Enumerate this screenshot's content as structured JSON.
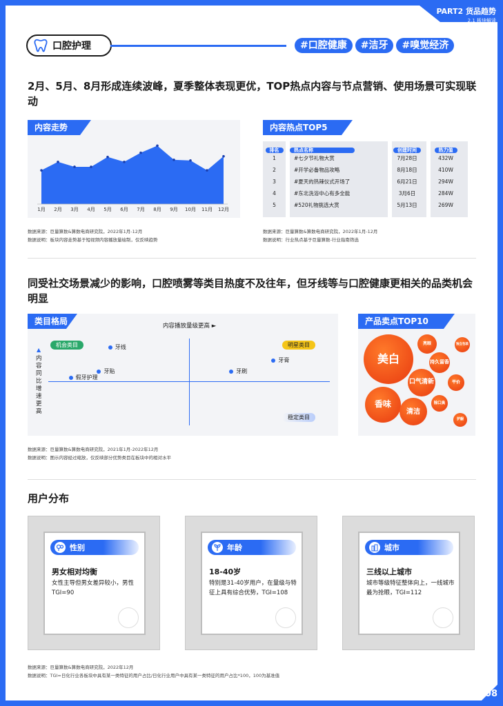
{
  "part": {
    "title": "PART2 货品趋势",
    "sub": "2.1 板块解读"
  },
  "page_number": "08",
  "brand": {
    "icon": "tooth-icon",
    "name": "口腔护理"
  },
  "tags": [
    "#口腔健康",
    "#洁牙",
    "#嗅觉经济"
  ],
  "section1": {
    "headline": "2月、5月、8月形成连续波峰，夏季整体表现更优，TOP热点内容与节点营销、使用场景可实现联动",
    "trend_tab": "内容走势",
    "top5_tab": "内容热点TOP5",
    "trend_note1": "数据来源：巨量算数&算数电商研究院，2022年1月-12月",
    "trend_note2": "数据说明：板块内容走势基于短视频内容播放量绘制，仅反映趋势",
    "top5_note1": "数据来源：巨量算数&算数电商研究院，2022年1月-12月",
    "top5_note2": "数据说明：行业热点基于巨量算数-行业指南筛选"
  },
  "chart_data": {
    "type": "area",
    "categories": [
      "1月",
      "2月",
      "3月",
      "4月",
      "5月",
      "6月",
      "7月",
      "8月",
      "9月",
      "10月",
      "11月",
      "12月"
    ],
    "values": [
      0.48,
      0.6,
      0.53,
      0.53,
      0.67,
      0.6,
      0.73,
      0.83,
      0.63,
      0.62,
      0.48,
      0.68
    ],
    "ylim": [
      0,
      1
    ],
    "color": "#2B6BF3"
  },
  "top5": {
    "headers": [
      "排名",
      "热点名称",
      "创建时间",
      "热力值"
    ],
    "rows": [
      [
        "1",
        "#七夕节礼物大赏",
        "7月28日",
        "432W"
      ],
      [
        "2",
        "#开学必备物品攻略",
        "8月18日",
        "410W"
      ],
      [
        "3",
        "#夏天的热辣仪式开场了",
        "6月21日",
        "294W"
      ],
      [
        "4",
        "#东北洗浴中心有多全能",
        "3月6日",
        "284W"
      ],
      [
        "5",
        "#520礼物挑选大赏",
        "5月13日",
        "269W"
      ]
    ]
  },
  "section2": {
    "headline": "同受社交场景减少的影响，口腔喷雾等类目热度不及往年，但牙线等与口腔健康更相关的品类机会明显",
    "quad_tab": "类目格局",
    "bubble_tab": "产品卖点TOP10",
    "x_axis": "内容播放量级更高 ►",
    "y_axis": "内容同比增速更高",
    "quadrants": {
      "opportunity": "机会类目",
      "star": "明星类目",
      "stable": "稳定类目"
    },
    "points": [
      {
        "label": "牙线",
        "x": 0.22,
        "y": 0.9
      },
      {
        "label": "牙贴",
        "x": 0.18,
        "y": 0.62
      },
      {
        "label": "假牙护理",
        "x": 0.08,
        "y": 0.55
      },
      {
        "label": "牙膏",
        "x": 0.8,
        "y": 0.75
      },
      {
        "label": "牙刷",
        "x": 0.65,
        "y": 0.62
      }
    ],
    "bubbles": [
      "美白",
      "香味",
      "清洁",
      "口气清新",
      "持久留香",
      "亮眼",
      "独立包装",
      "平价",
      "除口臭",
      "护龈"
    ],
    "note1": "数据来源：巨量算数&算数电商研究院，2021年1月-2022年12月",
    "note2": "数据说明：图示内容经过缩放，仅反映部分优势类目在板块中的相对水平"
  },
  "section3": {
    "title": "用户分布",
    "cards": [
      {
        "chip": "性别",
        "icon": "gender-icon",
        "title": "男女相对均衡",
        "desc": "女性主导但男女差异较小，男性TGI=90"
      },
      {
        "chip": "年龄",
        "icon": "sprout-icon",
        "title": "18-40岁",
        "desc": "特别是31-40岁用户，在量级与特征上具有综合优势，TGI=108"
      },
      {
        "chip": "城市",
        "icon": "building-icon",
        "title": "三线以上城市",
        "desc": "城市等级特征整体向上，一线城市最为抢眼，TGI=112"
      }
    ],
    "note1": "数据来源：巨量算数&算数电商研究院，2022年12月",
    "note2": "数据说明：TGI=日化行业各板块中具有某一类特征的用户占比/日化行业用户中具有某一类特征的用户占比*100，100为基准值"
  }
}
